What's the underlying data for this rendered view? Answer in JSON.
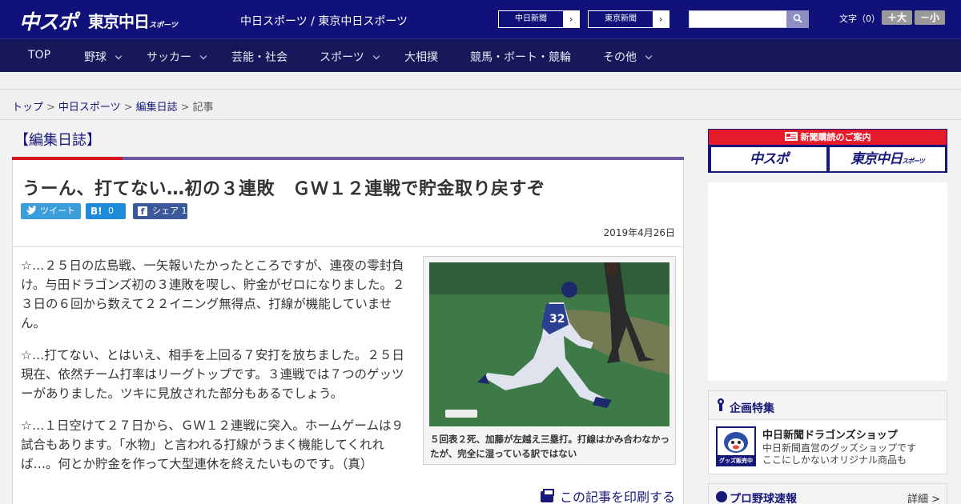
{
  "header": {
    "logo_chuspo": "中スポ",
    "logo_tokyo": "東京中日",
    "logo_tokyo_sub": "スポーツ",
    "site_title": "中日スポーツ / 東京中日スポーツ",
    "links": [
      {
        "label": "中日新聞",
        "arrow": "›"
      },
      {
        "label": "東京新聞",
        "arrow": "›"
      }
    ],
    "search_placeholder": "",
    "search_icon": "search-icon",
    "font_size_label": "文字（0）",
    "font_larger": "＋大",
    "font_smaller": "－小"
  },
  "nav": {
    "items": [
      {
        "label": "TOP",
        "dropdown": false
      },
      {
        "label": "野球",
        "dropdown": true
      },
      {
        "label": "サッカー",
        "dropdown": true
      },
      {
        "label": "芸能・社会",
        "dropdown": false
      },
      {
        "label": "スポーツ",
        "dropdown": true
      },
      {
        "label": "大相撲",
        "dropdown": false
      },
      {
        "label": "競馬・ボート・競輪",
        "dropdown": false
      },
      {
        "label": "その他",
        "dropdown": true
      }
    ]
  },
  "breadcrumb": {
    "items": [
      "トップ",
      "中日スポーツ",
      "編集日誌"
    ],
    "current": "記事",
    "separator": ">"
  },
  "section": {
    "title": "【編集日誌】"
  },
  "article": {
    "headline": "うーん、打てない…初の３連敗　ＧＷ１２連戦で貯金取り戻すぞ",
    "share": {
      "tweet": "ツイート",
      "hatena_icon": "B!",
      "hatena_count": "0",
      "facebook_icon": "f",
      "facebook": "シェア 1"
    },
    "date": "2019年4月26日",
    "paragraphs": [
      "☆…２５日の広島戦、一矢報いたかったところですが、連夜の零封負け。与田ドラゴンズ初の３連敗を喫し、貯金がゼロになりました。２３日の６回から数えて２２イニング無得点、打線が機能していません。",
      "☆…打てない、とはいえ、相手を上回る７安打を放ちました。２５日現在、依然チーム打率はリーグトップです。３連戦では７つのゲッツーがありました。ツキに見放された部分もあるでしょう。",
      "☆…１日空けて２７日から、ＧＷ１２連戦に突入。ホームゲームは９試合もあります。「水物」と言われる打線がうまく機能してくれれば…。何とか貯金を作って大型連休を終えたいものです。（真）"
    ],
    "photo": {
      "jersey_number": "32"
    },
    "caption": "５回表２死、加藤が左越え三塁打。打線はかみ合わなかったが、完全に湿っている訳ではない",
    "print_label": "この記事を印刷する"
  },
  "sidebar": {
    "subscribe": {
      "head": "新聞購読のご案内",
      "btn_chuspo": "中スポ",
      "btn_tokyo": "東京中日",
      "btn_tokyo_sub": "スポーツ"
    },
    "feature": {
      "title": "企画特集",
      "shop_title": "中日新聞ドラゴンズショップ",
      "shop_desc_1": "中日新聞直営のグッズショップです",
      "shop_desc_2": "ここにしかないオリジナル商品も",
      "shop_badge": "グッズ販売中"
    },
    "scores": {
      "title": "プロ野球速報",
      "detail": "詳細 >"
    }
  },
  "colors": {
    "header_bg": "#10127a",
    "nav_bg": "#16185a",
    "accent_red": "#d7161e",
    "accent_purple": "#6b5a9f",
    "link": "#16187a"
  }
}
